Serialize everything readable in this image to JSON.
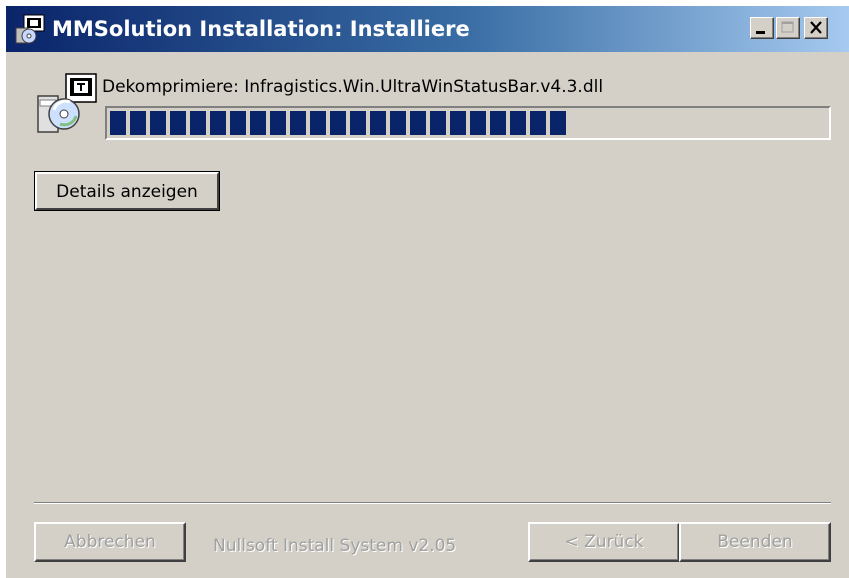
{
  "window": {
    "title": "MMSolution Installation: Installiere",
    "controls": {
      "minimize": "minimize",
      "maximize": "maximize",
      "close": "close"
    }
  },
  "install": {
    "status_text": "Dekomprimiere: Infragistics.Win.UltraWinStatusBar.v4.3.dll",
    "progress_fraction": 0.64,
    "details_button": "Details anzeigen"
  },
  "footer": {
    "cancel_button": "Abbrechen",
    "branding": "Nullsoft Install System v2.05",
    "back_button": "< Zurück",
    "finish_button": "Beenden"
  },
  "colors": {
    "progress": "#0a246a",
    "titlebar_start": "#0a246a",
    "titlebar_end": "#a6caf0",
    "face": "#d4d0c8"
  }
}
